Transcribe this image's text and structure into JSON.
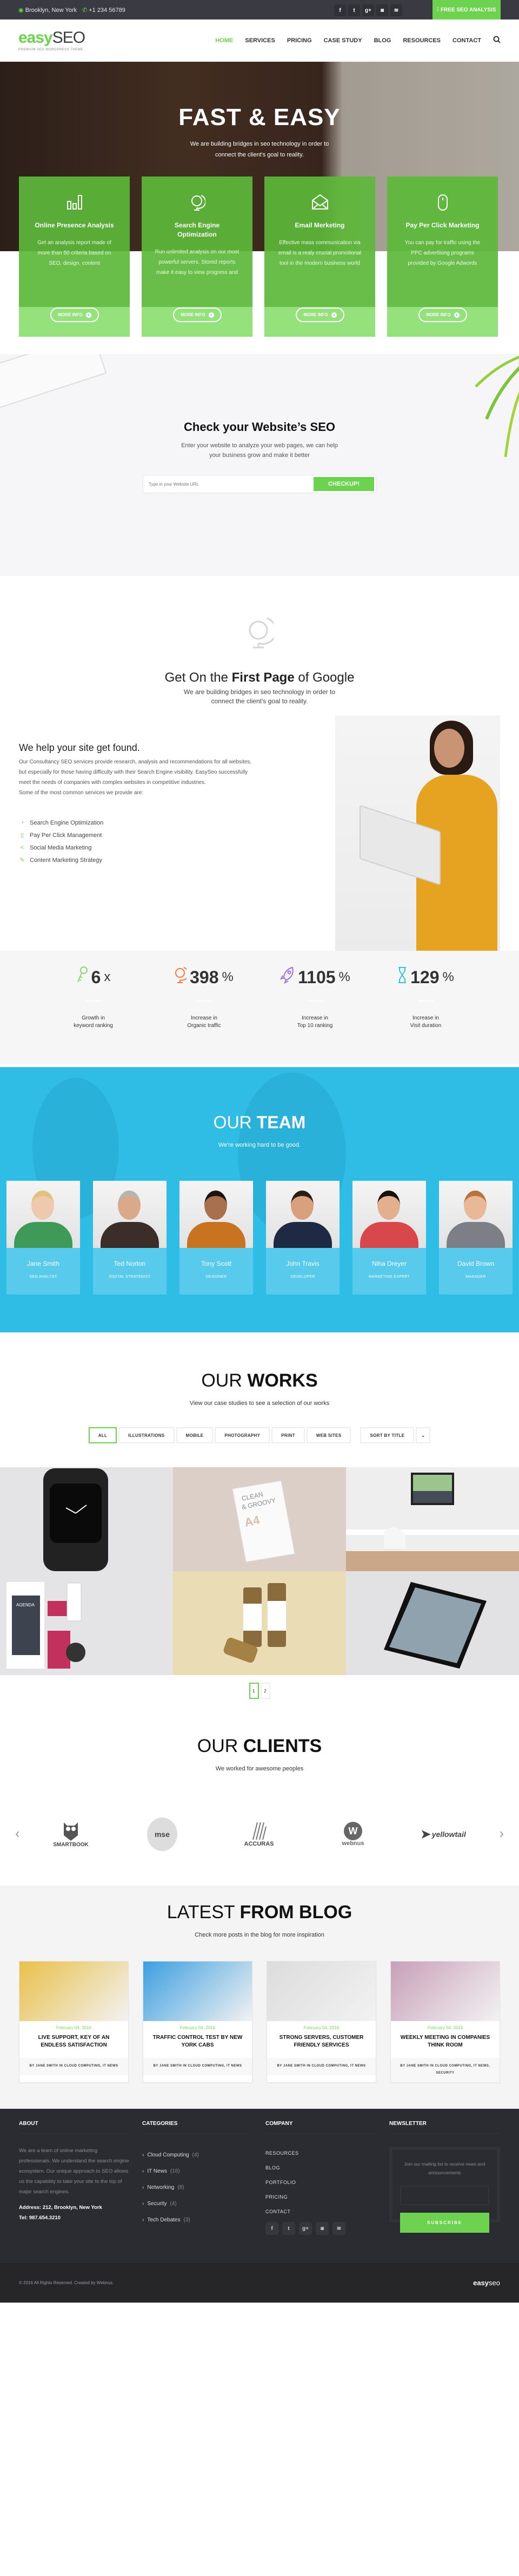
{
  "topbar": {
    "location": "Brooklyn, New York",
    "phone": "+1 234 56789",
    "social_icons": [
      "facebook-icon",
      "twitter-icon",
      "google-plus-icon",
      "instagram-icon",
      "rss-icon"
    ],
    "free_seo_label": "FREE SEO ANALYSIS"
  },
  "header": {
    "logo_easy": "easy",
    "logo_seo": "SEO",
    "logo_tagline": "PREMIUM SEO WORDPRESS THEME",
    "nav": [
      "HOME",
      "SERVICES",
      "PRICING",
      "CASE STUDY",
      "BLOG",
      "RESOURCES",
      "CONTACT"
    ],
    "active_nav": "HOME"
  },
  "hero": {
    "title": "FAST & EASY",
    "subtitle_line1": "We are building bridges in seo technology in order to",
    "subtitle_line2": "connect the client's goal to reality.",
    "services": [
      {
        "icon": "bar-chart-icon",
        "title": "Online Presence Analysis",
        "text": "Get an analysis report made of more than 50 criteria based on SEO, design, content",
        "button": "MORE INFO"
      },
      {
        "icon": "globe-icon",
        "title": "Search Engine Optimization",
        "text": "Run unlimited analysis on our most powerful servers. Stored reports make it easy to view progress and",
        "button": "MORE INFO"
      },
      {
        "icon": "envelope-open-icon",
        "title": "Email Merketing",
        "text": "Effective mass communication via email is a realy crucial promotional tool in the modern business world",
        "button": "MORE INFO"
      },
      {
        "icon": "mouse-icon",
        "title": "Pay Per Click Marketing",
        "text": "You can pay for traffic using the PPC advertising programs provided by Google Adwords",
        "button": "MORE INFO"
      }
    ]
  },
  "check_seo": {
    "title": "Check your Website’s SEO",
    "subtitle_line1": "Enter your website to analyze your web pages, we can help",
    "subtitle_line2": "your business grow and make it better",
    "input_placeholder": "Type in your Website URL",
    "input_value": "",
    "button": "CHECKUP!"
  },
  "google": {
    "title_prefix": "Get On the",
    "title_bold": "First Page",
    "title_suffix": "of Google",
    "subtitle_line1": "We are building bridges in seo technology in order to",
    "subtitle_line2": "connect the client's goal to reality."
  },
  "found": {
    "title": "We help your site get found.",
    "description": "Our Consultancy SEO services provide research, analysis and recommendations for all websites, but especially for those having difficulty with their Search Engine visibility. EasySeo successfully meet the needs of companies with complex websites in competitive industries.",
    "description2": "Some of the most common services we provide are:",
    "services": [
      {
        "icon": "speedometer-icon",
        "label": "Search Engine Optimization"
      },
      {
        "icon": "mouse-icon",
        "label": "Pay Per Click Management"
      },
      {
        "icon": "share-icon",
        "label": "Social Media Marketing"
      },
      {
        "icon": "edit-icon",
        "label": "Content Marketing Strategy"
      }
    ]
  },
  "stats": [
    {
      "icon": "key-icon",
      "color": "#8fd66f",
      "value": "6",
      "unit": "x",
      "label_line1": "Growth in",
      "label_line2": "keyword ranking"
    },
    {
      "icon": "globe-icon",
      "color": "#f07a3a",
      "value": "398",
      "unit": "%",
      "label_line1": "Increase in",
      "label_line2": "Organic traffic"
    },
    {
      "icon": "rocket-icon",
      "color": "#9b6ee0",
      "value": "1105",
      "unit": "%",
      "label_line1": "Increase in",
      "label_line2": "Top 10 ranking"
    },
    {
      "icon": "hourglass-icon",
      "color": "#2fc6d8",
      "value": "129",
      "unit": "%",
      "label_line1": "Increase in",
      "label_line2": "Visit duration"
    }
  ],
  "team": {
    "title_light": "OUR",
    "title_bold": "TEAM",
    "subtitle": "We're working hard to be good.",
    "members": [
      {
        "name": "Jane Smith",
        "role": "SEO ANALYST",
        "shirt": "#3f9a5a",
        "skin": "#efc9ad",
        "hair": "#e0c27d"
      },
      {
        "name": "Ted Norton",
        "role": "DIGITAL STRATEGIST",
        "shirt": "#3b2e28",
        "skin": "#d9a98a",
        "hair": "#b9b3ac"
      },
      {
        "name": "Tony Scott",
        "role": "DESIGNER",
        "shirt": "#c8731f",
        "skin": "#a8704e",
        "hair": "#1c1410"
      },
      {
        "name": "John Travis",
        "role": "DEVELOPER",
        "shirt": "#1e2a44",
        "skin": "#d9a07e",
        "hair": "#2a1d14"
      },
      {
        "name": "Niha Dreyer",
        "role": "MARKETING EXPERT",
        "shirt": "#d8474a",
        "skin": "#e2b08e",
        "hair": "#1a110c"
      },
      {
        "name": "David Brown",
        "role": "MANAGER",
        "shirt": "#7c7f86",
        "skin": "#e8b898",
        "hair": "#b8743e"
      }
    ]
  },
  "works": {
    "title_light": "OUR",
    "title_bold": "WORKS",
    "subtitle": "View our case studies to see a selection of our works",
    "filters": [
      "ALL",
      "ILLUSTRATIONS",
      "MOBILE",
      "PHOTOGRAPHY",
      "PRINT",
      "WEB SITES"
    ],
    "active_filter": "ALL",
    "sort_label": "SORT BY TITLE",
    "items": [
      {
        "name": "Smart watch mockup",
        "bg": "#e4e4e6"
      },
      {
        "name": "Clean & Groovy A4 brochure mockup",
        "bg": "#dccfc8"
      },
      {
        "name": "Desktop workspace mockup",
        "bg": "#eeeeee"
      },
      {
        "name": "Agenda stationery branding",
        "bg": "#e4e4e6"
      },
      {
        "name": "Glass jar mockup",
        "bg": "#eadcb5"
      },
      {
        "name": "Tablet mockup",
        "bg": "#e2e2e4"
      }
    ],
    "pages": [
      "1",
      "2"
    ],
    "active_page": "1"
  },
  "clients": {
    "title_light": "OUR",
    "title_bold": "CLIENTS",
    "subtitle": "We worked for awesome peoples",
    "logos": [
      "SMARTBOOK",
      "mse",
      "ACCURAS",
      "webnus",
      "yellowtail"
    ]
  },
  "blog": {
    "title_light": "LATEST",
    "title_bold": "FROM BLOG",
    "subtitle": "Check more posts in the blog for more inspiration",
    "posts": [
      {
        "date": "February 04, 2016",
        "title": "LIVE SUPPORT, KEY OF AN ENDLESS SATISFACTION",
        "meta": "BY JANE SMITH IN CLOUD COMPUTING, IT NEWS",
        "img": "#e9c04a"
      },
      {
        "date": "February 04, 2016",
        "title": "TRAFFIC CONTROL TEST BY NEW YORK CABS",
        "meta": "BY JANE SMITH IN CLOUD COMPUTING, IT NEWS",
        "img": "#3d9fe0"
      },
      {
        "date": "February 04, 2016",
        "title": "STRONG SERVERS, CUSTOMER FRIENDLY SERVICES",
        "meta": "BY JANE SMITH IN CLOUD COMPUTING, IT NEWS",
        "img": "#dcdcdc"
      },
      {
        "date": "February 04, 2016",
        "title": "WEEKLY MEETING IN COMPANIES THINK ROOM",
        "meta": "BY JANE SMITH IN CLOUD COMPUTING, IT NEWS, SECURITY",
        "img": "#c8a0b8"
      }
    ]
  },
  "footer": {
    "about_title": "ABOUT",
    "about_text": "We are a team of online marketing professionals. We understand the search engine ecosystem. Our unique approach to SEO allows us the capability to take your site to the top of major search engines.",
    "address": "Address: 212, Brooklyn, New York",
    "tel": "Tel: 987.654.3210",
    "categories_title": "CATEGORIES",
    "categories": [
      {
        "name": "Cloud Computing",
        "count": "(4)"
      },
      {
        "name": "IT News",
        "count": "(16)"
      },
      {
        "name": "Networking",
        "count": "(8)"
      },
      {
        "name": "Security",
        "count": "(4)"
      },
      {
        "name": "Tech Debates",
        "count": "(3)"
      }
    ],
    "company_title": "COMPANY",
    "company_links": [
      "RESOURCES",
      "BLOG",
      "PORTFOLIO",
      "PRICING",
      "CONTACT"
    ],
    "social_icons": [
      "facebook-icon",
      "twitter-icon",
      "google-plus-icon",
      "instagram-icon",
      "rss-icon"
    ],
    "newsletter_title": "NEWSLETTER",
    "newsletter_text": "Join our mailing list to receive news and announcements",
    "newsletter_input_value": "",
    "subscribe_label": "SUBSCRIBE",
    "copyright": "© 2016 All Rights Reserved. Created by Webnus.",
    "footer_logo_easy": "easy",
    "footer_logo_seo": "seo"
  },
  "colors": {
    "brand_green": "#6dd24f",
    "dark": "#2b2c31",
    "team_blue": "#2fbde6"
  }
}
